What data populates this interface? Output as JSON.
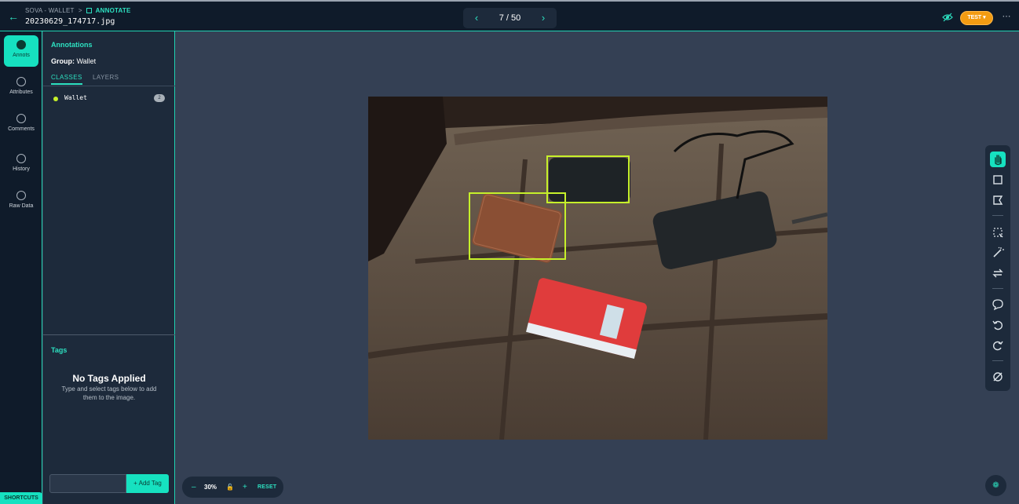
{
  "header": {
    "breadcrumb_project": "SOVA - WALLET",
    "breadcrumb_separator": ">",
    "breadcrumb_current": "ANNOTATE",
    "filename": "20230629_174717.jpg",
    "back_icon": "arrow-left-icon",
    "pager": {
      "current": 7,
      "total": 50,
      "label": "7 / 50"
    },
    "env_button": "TEST",
    "more_icon": "ellipsis-icon"
  },
  "rail": {
    "items": [
      {
        "label": "Annots",
        "icon": "annotation-icon",
        "active": true
      },
      {
        "label": "Attributes",
        "icon": "list-icon"
      },
      {
        "label": "Comments",
        "icon": "comment-icon"
      },
      {
        "label": "History",
        "icon": "history-icon"
      },
      {
        "label": "Raw Data",
        "icon": "code-icon"
      }
    ],
    "shortcuts_label": "SHORTCUTS"
  },
  "panel": {
    "title": "Annotations",
    "group_prefix": "Group:",
    "group_name": "Wallet",
    "tabs": [
      "CLASSES",
      "LAYERS"
    ],
    "classes": [
      {
        "name": "Wallet",
        "count": "2",
        "color": "#c6f02a"
      }
    ],
    "tags": {
      "title": "Tags",
      "empty_title": "No Tags Applied",
      "empty_subtitle": "Type and select tags below to add them to the image.",
      "input_placeholder": "",
      "add_button": "+ Add Tag"
    }
  },
  "zoom": {
    "value": "30%",
    "reset_label": "RESET"
  },
  "colors": {
    "accent": "#16e1c0",
    "bbox": "#c6f02a",
    "env": "#f39c12"
  }
}
